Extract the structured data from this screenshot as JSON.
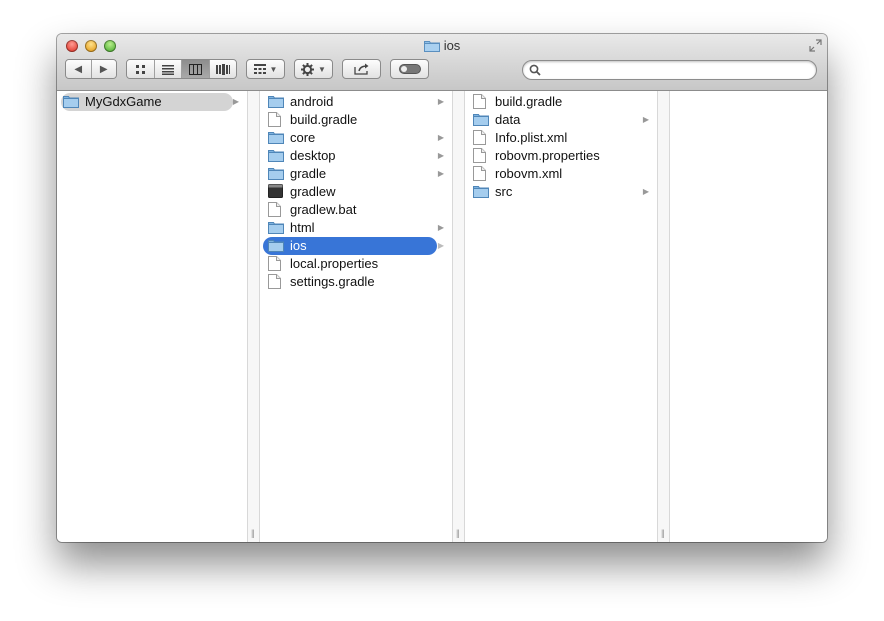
{
  "window": {
    "title": "ios"
  },
  "toolbar": {
    "back_glyph": "◀",
    "forward_glyph": "▶",
    "view_modes": [
      "icon-view",
      "list-view",
      "column-view",
      "coverflow-view"
    ],
    "active_view": "column-view",
    "search": {
      "value": "",
      "placeholder": ""
    }
  },
  "columns": [
    {
      "items": [
        {
          "name": "MyGdxGame",
          "kind": "folder",
          "has_children": true,
          "state": "selected-inactive"
        }
      ]
    },
    {
      "items": [
        {
          "name": "android",
          "kind": "folder",
          "has_children": true
        },
        {
          "name": "build.gradle",
          "kind": "file"
        },
        {
          "name": "core",
          "kind": "folder",
          "has_children": true
        },
        {
          "name": "desktop",
          "kind": "folder",
          "has_children": true
        },
        {
          "name": "gradle",
          "kind": "folder",
          "has_children": true
        },
        {
          "name": "gradlew",
          "kind": "executable"
        },
        {
          "name": "gradlew.bat",
          "kind": "file"
        },
        {
          "name": "html",
          "kind": "folder",
          "has_children": true
        },
        {
          "name": "ios",
          "kind": "folder",
          "has_children": true,
          "state": "selected"
        },
        {
          "name": "local.properties",
          "kind": "file"
        },
        {
          "name": "settings.gradle",
          "kind": "file"
        }
      ]
    },
    {
      "items": [
        {
          "name": "build.gradle",
          "kind": "file"
        },
        {
          "name": "data",
          "kind": "folder",
          "has_children": true
        },
        {
          "name": "Info.plist.xml",
          "kind": "file"
        },
        {
          "name": "robovm.properties",
          "kind": "file"
        },
        {
          "name": "robovm.xml",
          "kind": "file"
        },
        {
          "name": "src",
          "kind": "folder",
          "has_children": true
        }
      ]
    }
  ],
  "colors": {
    "selection": "#3875d7",
    "selection_inactive": "#d4d4d4",
    "folder": "#8fc0e8"
  }
}
